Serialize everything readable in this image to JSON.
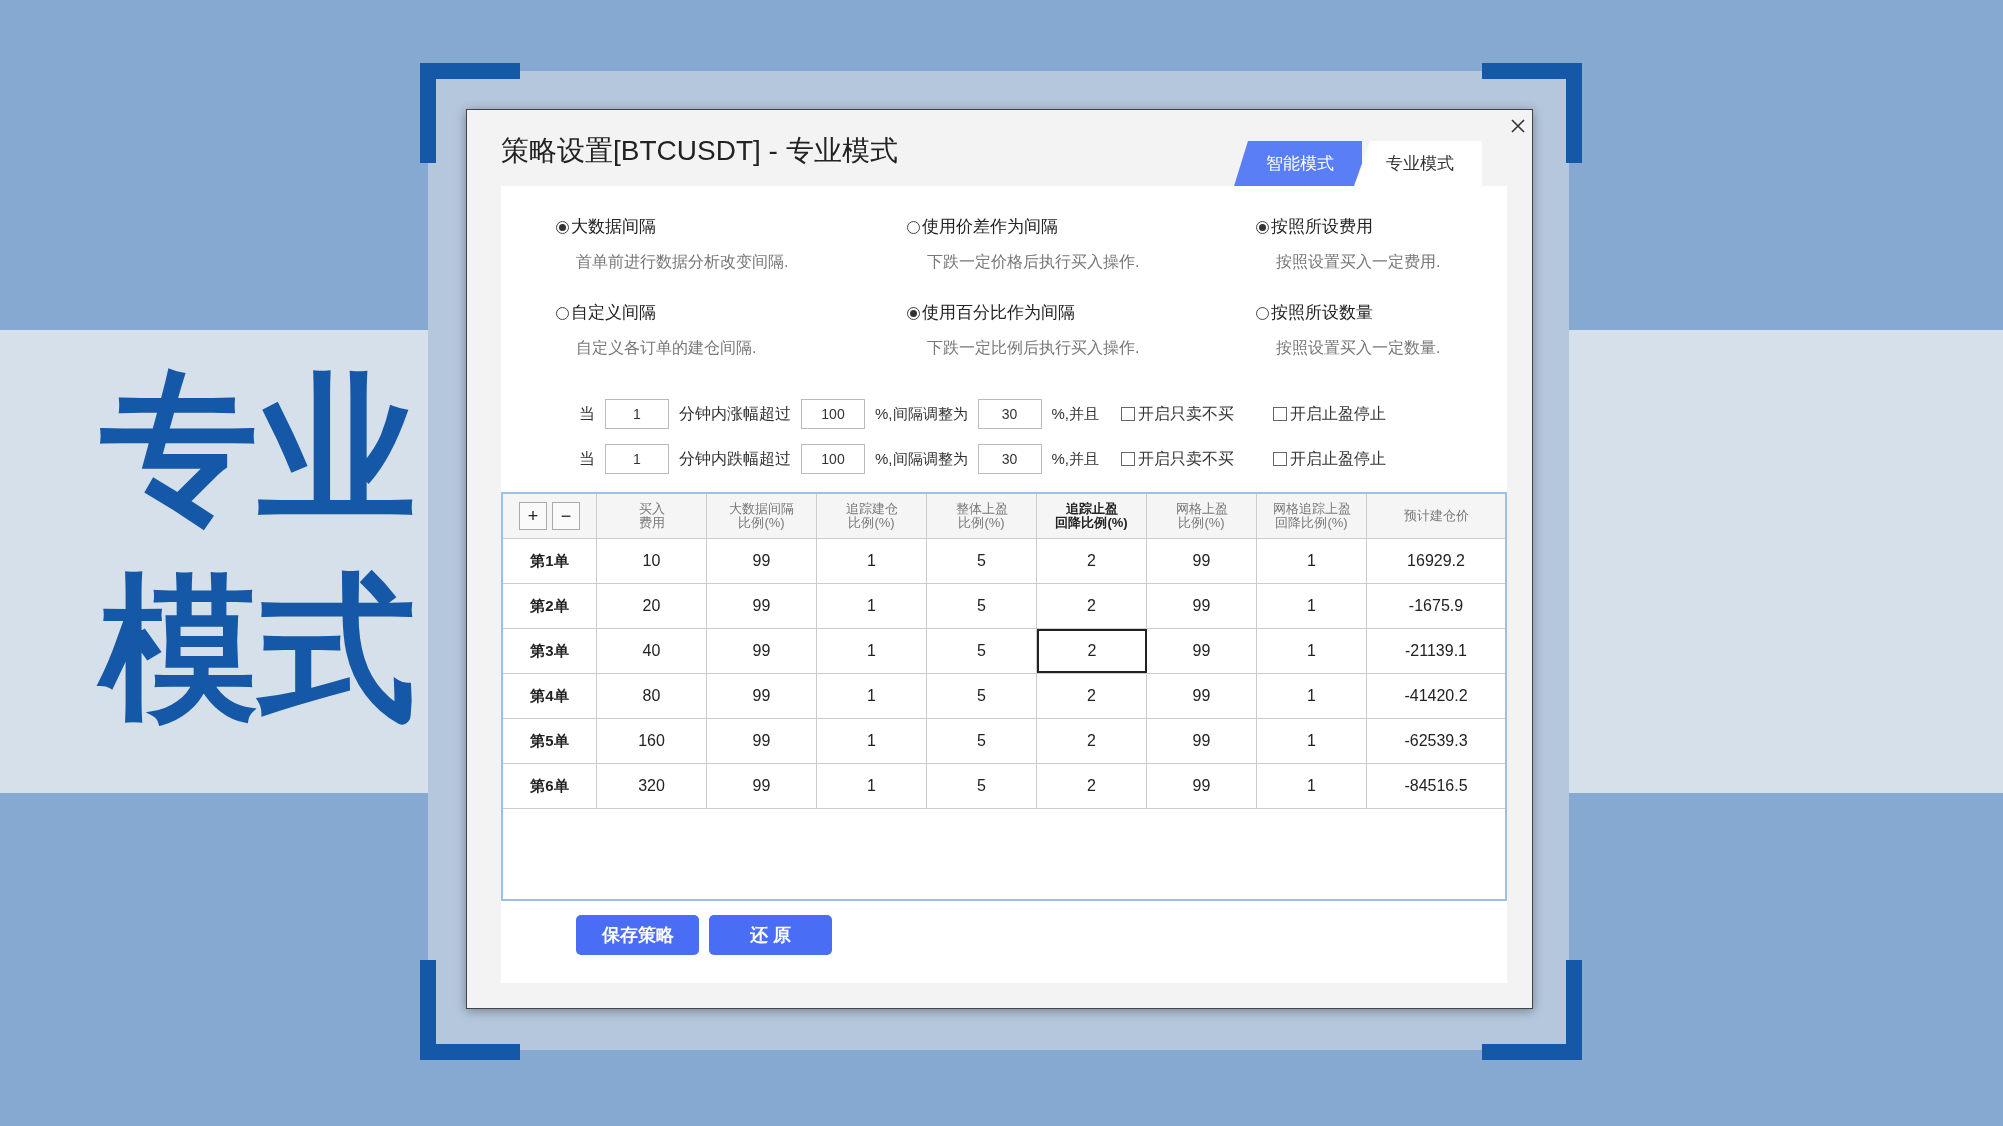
{
  "slide_title_lines": [
    "专业",
    "模式"
  ],
  "dialog": {
    "title": "策略设置[BTCUSDT] - 专业模式",
    "tabs": [
      {
        "label": "智能模式",
        "selected": false
      },
      {
        "label": "专业模式",
        "selected": true
      }
    ]
  },
  "option_groups": [
    {
      "options": [
        {
          "label": "大数据间隔",
          "description": "首单前进行数据分析改变间隔.",
          "selected": true
        },
        {
          "label": "自定义间隔",
          "description": "自定义各订单的建仓间隔.",
          "selected": false
        }
      ]
    },
    {
      "options": [
        {
          "label": "使用价差作为间隔",
          "description": "下跌一定价格后执行买入操作.",
          "selected": false
        },
        {
          "label": "使用百分比作为间隔",
          "description": "下跌一定比例后执行买入操作.",
          "selected": true
        }
      ]
    },
    {
      "options": [
        {
          "label": "按照所设费用",
          "description": "按照设置买入一定费用.",
          "selected": true
        },
        {
          "label": "按照所设数量",
          "description": "按照设置买入一定数量.",
          "selected": false
        }
      ]
    }
  ],
  "rules": [
    {
      "lead": "当",
      "minutes": "1",
      "condition": "分钟内涨幅超过",
      "threshold": "100",
      "adjust_label": "%,间隔调整为",
      "interval": "30",
      "join_label": "%,并且",
      "toggles": [
        {
          "label": "开启只卖不买",
          "checked": false
        },
        {
          "label": "开启止盈停止",
          "checked": false
        }
      ]
    },
    {
      "lead": "当",
      "minutes": "1",
      "condition": "分钟内跌幅超过",
      "threshold": "100",
      "adjust_label": "%,间隔调整为",
      "interval": "30",
      "join_label": "%,并且",
      "toggles": [
        {
          "label": "开启只卖不买",
          "checked": false
        },
        {
          "label": "开启止盈停止",
          "checked": false
        }
      ]
    }
  ],
  "table": {
    "add_button": "+",
    "remove_button": "−",
    "columns": [
      {
        "lines": [
          "买入",
          "费用"
        ],
        "bold": false
      },
      {
        "lines": [
          "大数据间隔",
          "比例(%)"
        ],
        "bold": false
      },
      {
        "lines": [
          "追踪建仓",
          "比例(%)"
        ],
        "bold": false
      },
      {
        "lines": [
          "整体上盈",
          "比例(%)"
        ],
        "bold": false
      },
      {
        "lines": [
          "追踪止盈",
          "回降比例(%)"
        ],
        "bold": true
      },
      {
        "lines": [
          "网格上盈",
          "比例(%)"
        ],
        "bold": false
      },
      {
        "lines": [
          "网格追踪上盈",
          "回降比例(%)"
        ],
        "bold": false
      },
      {
        "lines": [
          "预计建仓价"
        ],
        "bold": false
      }
    ],
    "rows": [
      {
        "label": "第1单",
        "cells": [
          {
            "text": "10",
            "selected": false
          },
          {
            "text": "99",
            "selected": false
          },
          {
            "text": "1",
            "selected": false
          },
          {
            "text": "5",
            "selected": false
          },
          {
            "text": "2",
            "selected": false
          },
          {
            "text": "99",
            "selected": false
          },
          {
            "text": "1",
            "selected": false
          },
          {
            "text": "16929.2",
            "selected": false
          }
        ]
      },
      {
        "label": "第2单",
        "cells": [
          {
            "text": "20",
            "selected": false
          },
          {
            "text": "99",
            "selected": false
          },
          {
            "text": "1",
            "selected": false
          },
          {
            "text": "5",
            "selected": false
          },
          {
            "text": "2",
            "selected": false
          },
          {
            "text": "99",
            "selected": false
          },
          {
            "text": "1",
            "selected": false
          },
          {
            "text": "-1675.9",
            "selected": false
          }
        ]
      },
      {
        "label": "第3单",
        "cells": [
          {
            "text": "40",
            "selected": false
          },
          {
            "text": "99",
            "selected": false
          },
          {
            "text": "1",
            "selected": false
          },
          {
            "text": "5",
            "selected": false
          },
          {
            "text": "2",
            "selected": true
          },
          {
            "text": "99",
            "selected": false
          },
          {
            "text": "1",
            "selected": false
          },
          {
            "text": "-21139.1",
            "selected": false
          }
        ]
      },
      {
        "label": "第4单",
        "cells": [
          {
            "text": "80",
            "selected": false
          },
          {
            "text": "99",
            "selected": false
          },
          {
            "text": "1",
            "selected": false
          },
          {
            "text": "5",
            "selected": false
          },
          {
            "text": "2",
            "selected": false
          },
          {
            "text": "99",
            "selected": false
          },
          {
            "text": "1",
            "selected": false
          },
          {
            "text": "-41420.2",
            "selected": false
          }
        ]
      },
      {
        "label": "第5单",
        "cells": [
          {
            "text": "160",
            "selected": false
          },
          {
            "text": "99",
            "selected": false
          },
          {
            "text": "1",
            "selected": false
          },
          {
            "text": "5",
            "selected": false
          },
          {
            "text": "2",
            "selected": false
          },
          {
            "text": "99",
            "selected": false
          },
          {
            "text": "1",
            "selected": false
          },
          {
            "text": "-62539.3",
            "selected": false
          }
        ]
      },
      {
        "label": "第6单",
        "cells": [
          {
            "text": "320",
            "selected": false
          },
          {
            "text": "99",
            "selected": false
          },
          {
            "text": "1",
            "selected": false
          },
          {
            "text": "5",
            "selected": false
          },
          {
            "text": "2",
            "selected": false
          },
          {
            "text": "99",
            "selected": false
          },
          {
            "text": "1",
            "selected": false
          },
          {
            "text": "-84516.5",
            "selected": false
          }
        ]
      }
    ]
  },
  "buttons": [
    "保存策略",
    "还 原"
  ]
}
